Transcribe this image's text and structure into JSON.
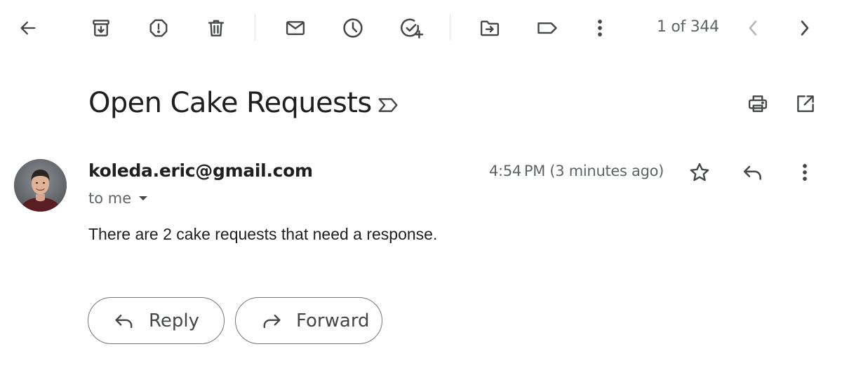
{
  "toolbar": {
    "back": "back-arrow-icon",
    "actions": [
      "archive-icon",
      "report-spam-icon",
      "delete-icon",
      "mark-unread-icon",
      "snooze-icon",
      "add-task-icon",
      "move-to-icon",
      "label-icon",
      "more-vert-icon"
    ],
    "pagination": "1 of 344"
  },
  "message": {
    "subject": "Open Cake Requests",
    "sender": "koleda.eric@gmail.com",
    "recipient": "to me",
    "timestamp": "4:54 PM (3 minutes ago)",
    "body": "There are 2 cake requests that need a response."
  },
  "actions": {
    "reply_label": "Reply",
    "forward_label": "Forward"
  },
  "colors": {
    "icon": "#444746",
    "disabled_icon": "#b4b8bc",
    "text_primary": "#1f1f1f",
    "text_secondary": "#5f6368",
    "pill_border": "#747775"
  }
}
